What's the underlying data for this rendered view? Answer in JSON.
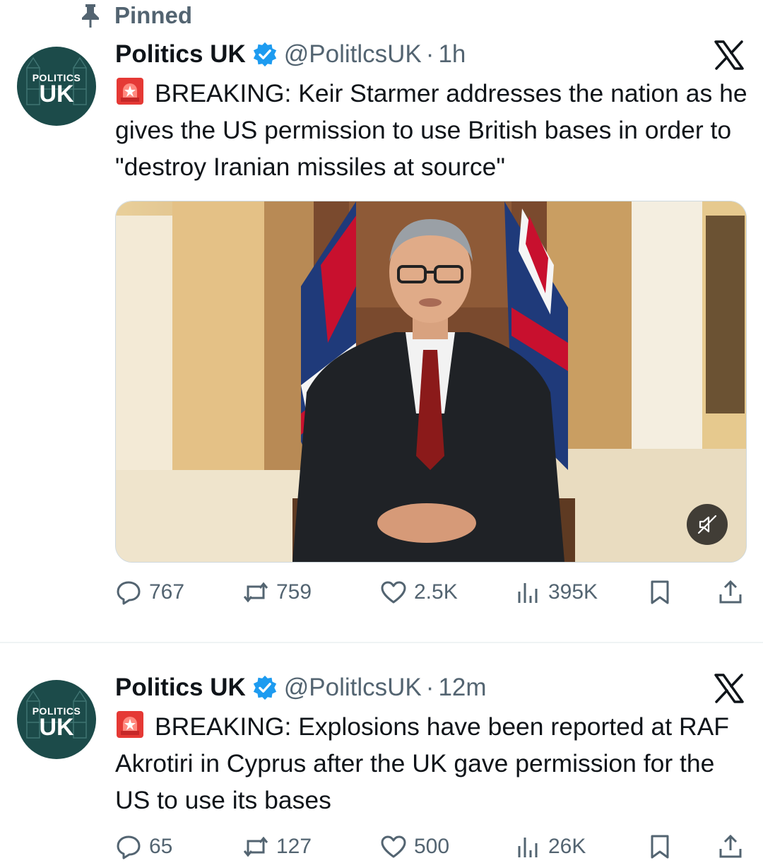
{
  "pinned": {
    "label": "Pinned",
    "icon": "pin-icon"
  },
  "tweets": [
    {
      "author": {
        "name": "Politics UK",
        "handle": "@PolitlcsUK",
        "verified": true,
        "avatar_small": "POLITICS",
        "avatar_big": "UK"
      },
      "separator": "·",
      "time": "1h",
      "icon": "siren-emoji",
      "text": "BREAKING: Keir Starmer addresses the nation as he gives the US permission to use British bases in order to \"destroy Iranian missiles at source\"",
      "media": {
        "type": "video",
        "muted": true
      },
      "stats": {
        "replies": "767",
        "reposts": "759",
        "likes": "2.5K",
        "views": "395K"
      }
    },
    {
      "author": {
        "name": "Politics UK",
        "handle": "@PolitlcsUK",
        "verified": true,
        "avatar_small": "POLITICS",
        "avatar_big": "UK"
      },
      "separator": "·",
      "time": "12m",
      "icon": "siren-emoji",
      "text": "BREAKING: Explosions have been reported at RAF Akrotiri in Cyprus after the UK gave permission for the US to use its bases",
      "stats": {
        "replies": "65",
        "reposts": "127",
        "likes": "500",
        "views": "26K"
      }
    }
  ],
  "colors": {
    "accent": "#1d9bf0",
    "text": "#0f1419",
    "muted": "#536471",
    "avatar_bg": "#1c4b4a"
  }
}
